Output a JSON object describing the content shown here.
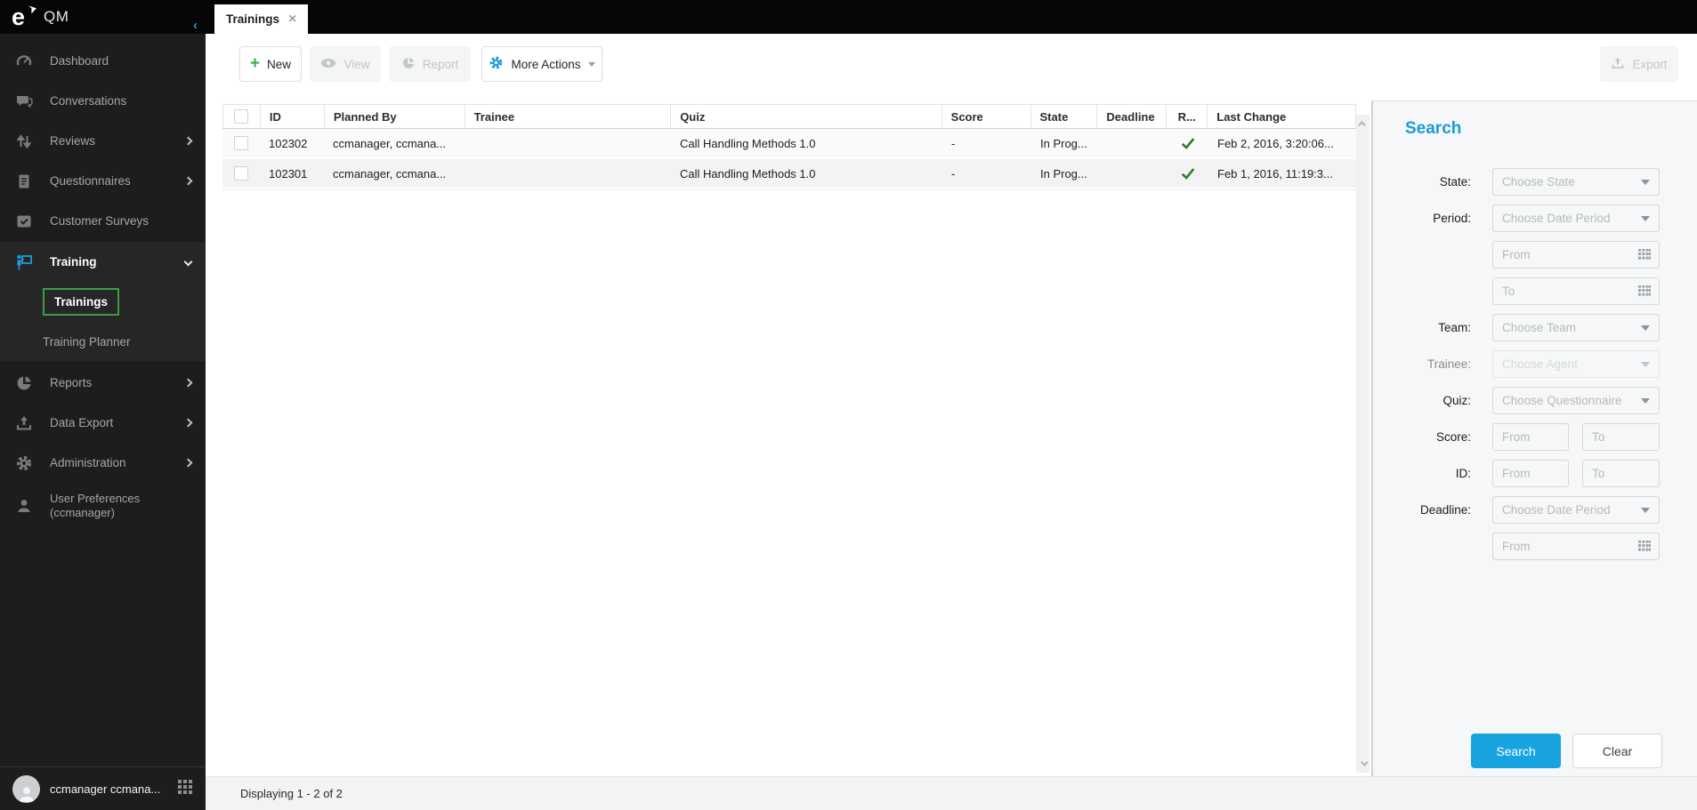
{
  "app": {
    "logo_text": "e",
    "title": "QM",
    "collapse_icon": "‹"
  },
  "tab": {
    "label": "Trainings",
    "close_icon": "×"
  },
  "sidebar": {
    "items": [
      {
        "label": "Dashboard"
      },
      {
        "label": "Conversations"
      },
      {
        "label": "Reviews"
      },
      {
        "label": "Questionnaires"
      },
      {
        "label": "Customer Surveys"
      },
      {
        "label": "Training"
      },
      {
        "label": "Trainings"
      },
      {
        "label": "Training Planner"
      },
      {
        "label": "Reports"
      },
      {
        "label": "Data Export"
      },
      {
        "label": "Administration"
      },
      {
        "label": "User Preferences (ccmanager)"
      }
    ],
    "user": {
      "name": "ccmanager ccmana..."
    }
  },
  "toolbar": {
    "new_label": "New",
    "view_label": "View",
    "report_label": "Report",
    "more_actions_label": "More Actions",
    "export_label": "Export"
  },
  "table": {
    "columns": [
      "ID",
      "Planned By",
      "Trainee",
      "Quiz",
      "Score",
      "State",
      "Deadline",
      "R...",
      "Last Change"
    ],
    "rows": [
      {
        "id": "102302",
        "planned_by": "ccmanager, ccmana...",
        "trainee_redacted": true,
        "quiz": "Call Handling Methods 1.0",
        "score": "-",
        "state": "In Prog...",
        "deadline": "",
        "remote_checked": true,
        "last_change": "Feb 2, 2016, 3:20:06..."
      },
      {
        "id": "102301",
        "planned_by": "ccmanager, ccmana...",
        "trainee_redacted": true,
        "quiz": "Call Handling Methods 1.0",
        "score": "-",
        "state": "In Prog...",
        "deadline": "",
        "remote_checked": true,
        "last_change": "Feb 1, 2016, 11:19:3..."
      }
    ],
    "status": "Displaying 1 - 2 of 2"
  },
  "search": {
    "title": "Search",
    "rows": [
      {
        "label": "State:",
        "placeholder": "Choose State"
      },
      {
        "label": "Period:",
        "placeholder": "Choose Date Period"
      },
      {
        "placeholder": "From"
      },
      {
        "placeholder": "To"
      },
      {
        "label": "Team:",
        "placeholder": "Choose Team"
      },
      {
        "label": "Trainee:",
        "placeholder": "Choose Agent",
        "disabled": true
      },
      {
        "label": "Quiz:",
        "placeholder": "Choose Questionnaire"
      },
      {
        "label": "Score:",
        "from": "From",
        "to": "To"
      },
      {
        "label": "ID:",
        "from": "From",
        "to": "To"
      },
      {
        "label": "Deadline:",
        "placeholder": "Choose Date Period"
      },
      {
        "placeholder": "From"
      }
    ],
    "buttons": {
      "search": "Search",
      "clear": "Clear"
    }
  },
  "icons": {
    "logo": "enghouse-e-mark",
    "collapse": "chevron-left",
    "close": "close-x",
    "new": "plus",
    "view": "eye",
    "report": "pie-chart",
    "more_actions": "gear",
    "export": "upload-tray",
    "remote": "green-checkmark",
    "calendar": "calendar-grid",
    "dropdown": "triangle-down",
    "apps": "grid-3x3"
  },
  "colors": {
    "accent_blue": "#1b9cd8",
    "search_button_blue": "#17a3df",
    "selected_green_border": "#3e9b45",
    "plus_green": "#3fae49",
    "checkmark_green": "#2e7d32",
    "sidebar_bg": "#1d1d1d",
    "topbar_bg": "#060606",
    "panel_bg": "#f5f7f8"
  }
}
